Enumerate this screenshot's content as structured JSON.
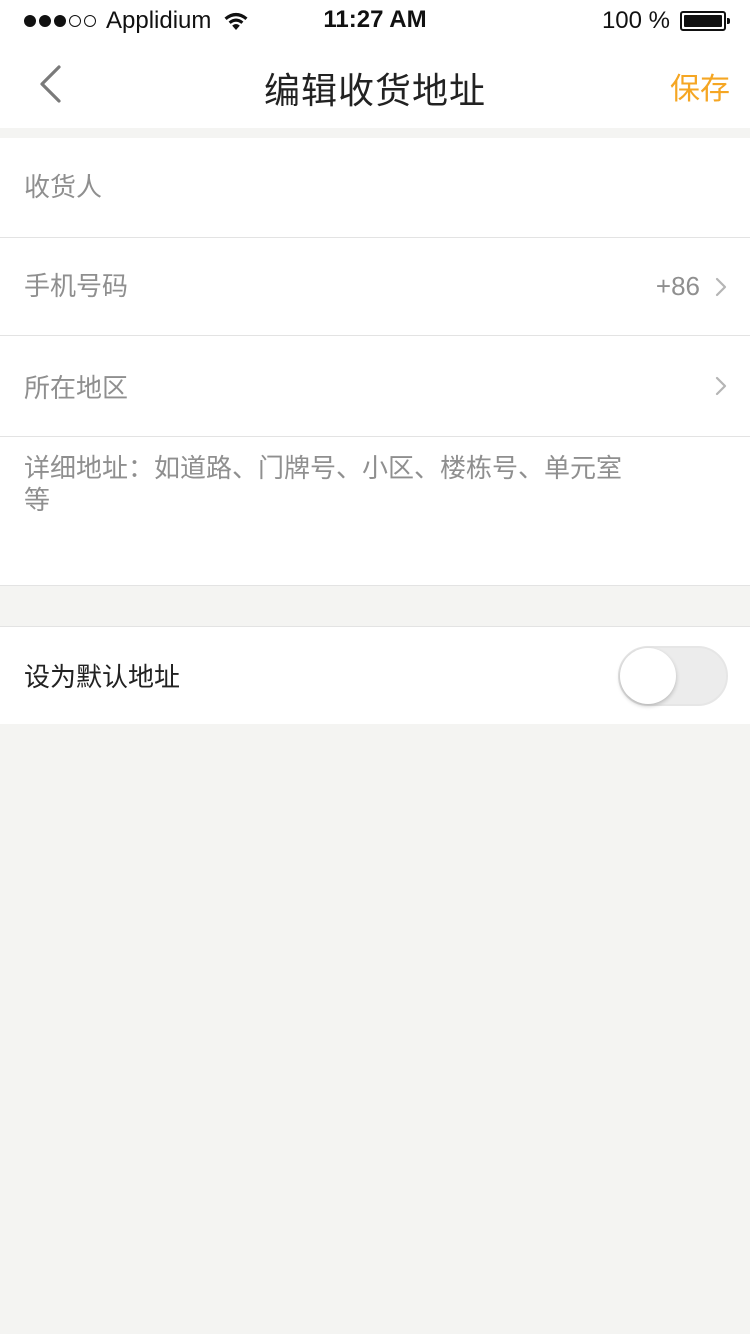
{
  "status_bar": {
    "carrier": "Applidium",
    "time": "11:27 AM",
    "battery": "100 %",
    "signal_dots_filled": 3,
    "signal_dots_total": 5,
    "battery_level": 1.0
  },
  "nav": {
    "title": "编辑收货地址",
    "save_label": "保存",
    "accent_color": "#f5a623"
  },
  "form": {
    "recipient": {
      "placeholder": "收货人",
      "value": ""
    },
    "phone": {
      "placeholder": "手机号码",
      "value": "",
      "country_code": "+86"
    },
    "region": {
      "label": "所在地区"
    },
    "detail": {
      "placeholder": "详细地址：如道路、门牌号、小区、楼栋号、单元室等",
      "value": ""
    }
  },
  "default_address": {
    "label": "设为默认地址",
    "enabled": false
  }
}
